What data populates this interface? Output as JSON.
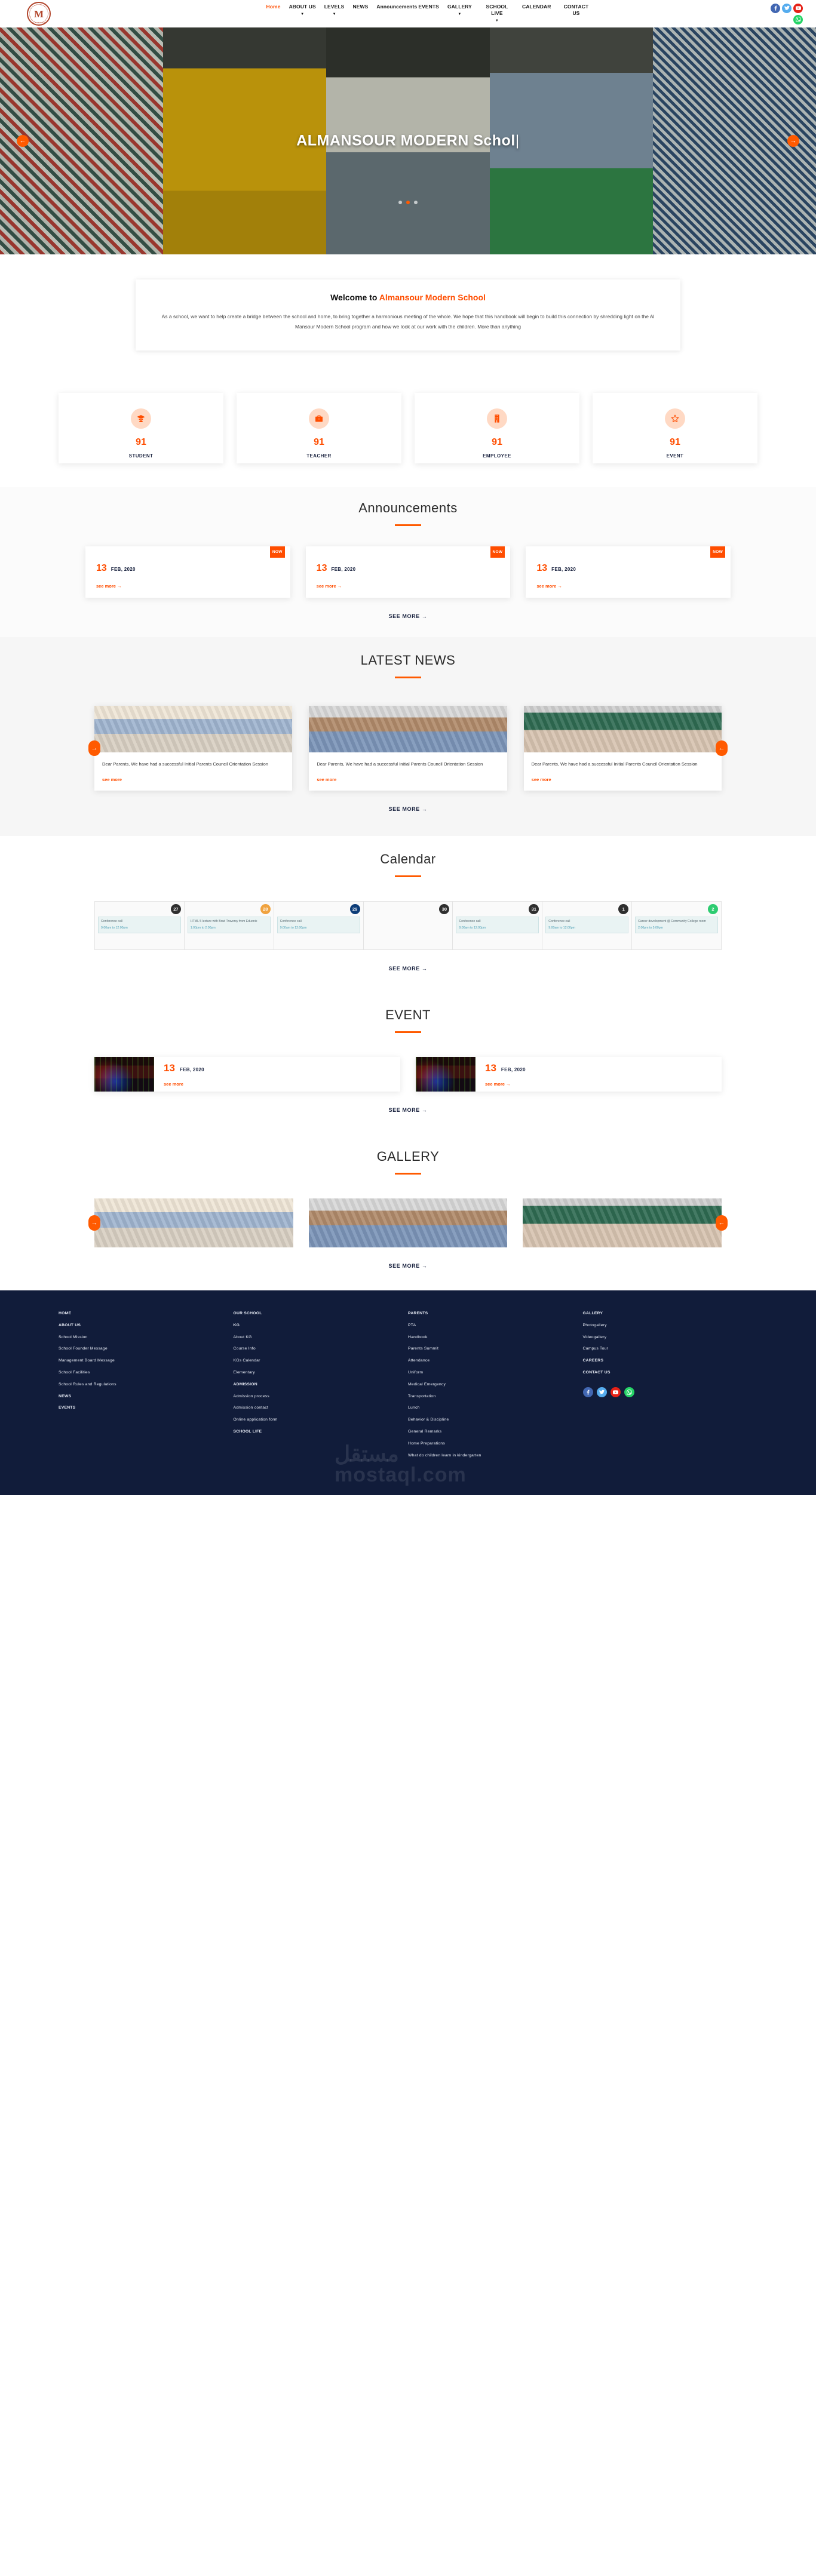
{
  "brand": {
    "logo_mark": "M",
    "logo_top": "AL MANSOUR MODERN SCHOOL",
    "logo_bottom": "AL MANSOUR",
    "logo_sub": "MODERN SCHOOL"
  },
  "nav": {
    "items": [
      {
        "label": "Home",
        "active": true,
        "caret": false
      },
      {
        "label": "ABOUT US",
        "active": false,
        "caret": true
      },
      {
        "label": "LEVELS",
        "active": false,
        "caret": true
      },
      {
        "label": "NEWS",
        "active": false,
        "caret": false
      },
      {
        "label": "Announcements",
        "active": false,
        "caret": false
      },
      {
        "label": "EVENTS",
        "active": false,
        "caret": false
      },
      {
        "label": "GALLERY",
        "active": false,
        "caret": true
      },
      {
        "label": "SCHOOL LIVE",
        "active": false,
        "caret": true
      },
      {
        "label": "CALENDAR",
        "active": false,
        "caret": false
      },
      {
        "label": "CONTACT US",
        "active": false,
        "caret": false
      }
    ],
    "social": [
      "facebook-icon",
      "twitter-icon",
      "youtube-icon",
      "whatsapp-icon"
    ]
  },
  "hero": {
    "title": "ALMANSOUR MODERN Schol",
    "cursor": "|",
    "prev_arrow": "←",
    "next_arrow": "→",
    "dots": 3,
    "active_dot": 2
  },
  "welcome": {
    "heading_prefix": "Welcome to ",
    "heading_highlight": "Almansour Modern School",
    "body": "As a school, we want to help create a bridge between the school and home, to bring together a harmonious meeting of the whole. We hope that this handbook will begin to build this connection by shredding light on the Al Mansour Modern School program and how we look at our work with the children. More than anything"
  },
  "stats": [
    {
      "icon": "graduate-icon",
      "value": "91",
      "label": "STUDENT"
    },
    {
      "icon": "briefcase-icon",
      "value": "91",
      "label": "TEACHER"
    },
    {
      "icon": "building-icon",
      "value": "91",
      "label": "EMPLOYEE"
    },
    {
      "icon": "star-icon",
      "value": "91",
      "label": "EVENT"
    }
  ],
  "announcements": {
    "title": "Announcements",
    "cards": [
      {
        "badge": "NOW",
        "day": "13",
        "month": "FEB, 2020",
        "link": "see more →"
      },
      {
        "badge": "NOW",
        "day": "13",
        "month": "FEB, 2020",
        "link": "see more →"
      },
      {
        "badge": "NOW",
        "day": "13",
        "month": "FEB, 2020",
        "link": "see more →"
      }
    ],
    "see_more": "SEE MORE →"
  },
  "news": {
    "title": "LATEST NEWS",
    "prev_arrow": "→",
    "next_arrow": "←",
    "cards": [
      {
        "text": "Dear Parents, We have had a successful Initial Parents Council Orientation Session",
        "link": "see more"
      },
      {
        "text": "Dear Parents, We have had a successful Initial Parents Council Orientation Session",
        "link": "see more"
      },
      {
        "text": "Dear Parents, We have had a successful Initial Parents Council Orientation Session",
        "link": "see more"
      }
    ],
    "see_more": "SEE MORE →"
  },
  "calendar": {
    "title": "Calendar",
    "days": [
      {
        "num": "27",
        "color": "dark",
        "event_title": "Conference call",
        "event_time": "9:00am to 12:00pm"
      },
      {
        "num": "28",
        "color": "orange",
        "event_title": "HTML 5 lecture with Brad Traversy from Eduonix",
        "event_time": "1:00pm to 2:00pm"
      },
      {
        "num": "29",
        "color": "navy",
        "event_title": "Conference call",
        "event_time": "9:00am to 12:00pm"
      },
      {
        "num": "30",
        "color": "dark",
        "event_title": "",
        "event_time": ""
      },
      {
        "num": "31",
        "color": "dark",
        "event_title": "Conference call",
        "event_time": "9:00am to 12:00pm"
      },
      {
        "num": "1",
        "color": "dark",
        "event_title": "Conference call",
        "event_time": "9:00am to 12:00pm"
      },
      {
        "num": "2",
        "color": "green",
        "event_title": "Career development @ Community College room",
        "event_time": "2:00pm to 5:00pm"
      }
    ],
    "see_more": "SEE MORE →"
  },
  "events": {
    "title": "EVENT",
    "cards": [
      {
        "day": "13",
        "month": "FEB, 2020",
        "link": "see more"
      },
      {
        "day": "13",
        "month": "FEB, 2020",
        "link": "see more →"
      }
    ],
    "see_more": "SEE MORE →"
  },
  "gallery": {
    "title": "GALLERY",
    "prev_arrow": "→",
    "next_arrow": "←",
    "see_more": "SEE MORE →"
  },
  "footer": {
    "columns": [
      {
        "items": [
          {
            "label": "HOME",
            "head": true
          },
          {
            "label": "ABOUT US",
            "head": true
          },
          {
            "label": "School Mission",
            "head": false
          },
          {
            "label": "School Founder Message",
            "head": false
          },
          {
            "label": "Management Board Message",
            "head": false
          },
          {
            "label": "School Facilities",
            "head": false
          },
          {
            "label": "School Rules and Regulations",
            "head": false
          },
          {
            "label": "NEWS",
            "head": true
          },
          {
            "label": "EVENTS",
            "head": true
          }
        ]
      },
      {
        "items": [
          {
            "label": "OUR SCHOOL",
            "head": true
          },
          {
            "label": "KG",
            "head": true
          },
          {
            "label": "About KG",
            "head": false
          },
          {
            "label": "Course Info",
            "head": false
          },
          {
            "label": "KGs Calendar",
            "head": false
          },
          {
            "label": "Elementary",
            "head": false
          },
          {
            "label": "ADMISSION",
            "head": true
          },
          {
            "label": "Admission process",
            "head": false
          },
          {
            "label": "Admission contact",
            "head": false
          },
          {
            "label": "Online application form",
            "head": false
          },
          {
            "label": "SCHOOL LIFE",
            "head": true
          }
        ]
      },
      {
        "items": [
          {
            "label": "PARENTS",
            "head": true
          },
          {
            "label": "PTA",
            "head": false
          },
          {
            "label": "Handbook",
            "head": false
          },
          {
            "label": "Parents Summit",
            "head": false
          },
          {
            "label": "Attendance",
            "head": false
          },
          {
            "label": "Uniform",
            "head": false
          },
          {
            "label": "Medical Emergency",
            "head": false
          },
          {
            "label": "Transportation",
            "head": false
          },
          {
            "label": "Lunch",
            "head": false
          },
          {
            "label": "Behavior & Discipline",
            "head": false
          },
          {
            "label": "General Remarks",
            "head": false
          },
          {
            "label": "Home Preparations",
            "head": false
          },
          {
            "label": "What do children learn in kindergarten",
            "head": false
          }
        ]
      },
      {
        "items": [
          {
            "label": "GALLERY",
            "head": true
          },
          {
            "label": "Photogallery",
            "head": false
          },
          {
            "label": "Videogallery",
            "head": false
          },
          {
            "label": "Campus Tour",
            "head": false
          },
          {
            "label": "CAREERS",
            "head": true
          },
          {
            "label": "CONTACT US",
            "head": true
          }
        ]
      }
    ],
    "social": [
      "facebook-icon",
      "twitter-icon",
      "youtube-icon",
      "whatsapp-icon"
    ],
    "watermark_ar": "مستقل",
    "watermark_en": "mostaql.com"
  },
  "colors": {
    "accent": "#ff4d00",
    "accent_alt": "#ff5a00",
    "footer_bg": "#111c3a",
    "navy_text": "#1b2440"
  }
}
